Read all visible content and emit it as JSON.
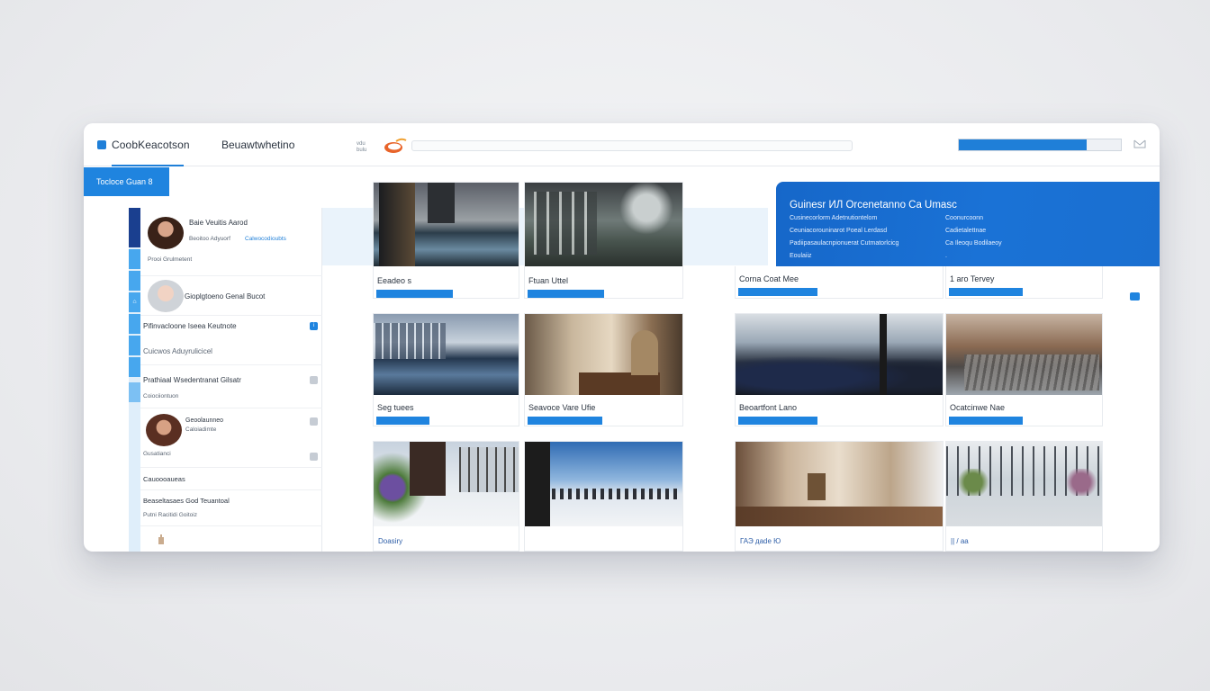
{
  "header": {
    "app_title": "CoobKeacotson",
    "nav_item": "Beuawtwhetino",
    "mini_logo_text": "vdu\nbulu",
    "progress_fraction": 0.79,
    "accent": "#1f7fd8",
    "active_tab": "Tocloce Guan 8"
  },
  "sidebar": {
    "rail_icons": [
      "-",
      "-",
      "⌂",
      "-",
      "-",
      "-",
      "-",
      "-"
    ],
    "items": [
      {
        "title": "Baie Veuitis Aarod",
        "sub": "Beoitoo Adyuorf",
        "link": "Calwocodioubts",
        "meta": "Prooi Grulmetent",
        "avatar": "person-dark-hair"
      },
      {
        "title": "Gioplgtoeno Genal Bucot",
        "avatar": "person-grey-hair"
      },
      {
        "title": "Pifinvacloone Iseea Keutnote",
        "badge": "i"
      },
      {
        "title": "Cuicwos Aduyrulicicel"
      },
      {
        "title": "Prathiaal Wsedentranat Gilsatr",
        "sub": "Coiociiontuon"
      },
      {
        "title": "Geoolaunneo",
        "sub": "Caloiadimte",
        "meta": "Gusatianci",
        "avatar": "person-curly-hair"
      },
      {
        "title": "Cauoooaueas"
      },
      {
        "title": "Beaseltasaes God Teuantoal",
        "sub": "Putni Racitidi Goitoiz"
      }
    ]
  },
  "gallery": {
    "cards": [
      {
        "title": "Eeadeo s",
        "progress": 0.52
      },
      {
        "title": "Ftuan Uttel",
        "progress": 0.48
      },
      {
        "title": "Corna Coat Mee",
        "progress": 0.38
      },
      {
        "title": "1 aro Tervey",
        "progress": 0.47
      },
      {
        "title": "Seg tuees",
        "progress": 0.36
      },
      {
        "title": "Seavoce Vare Ufie",
        "progress": 0.47
      },
      {
        "title": "Beoartfont Lano",
        "progress": 0.38
      },
      {
        "title": "Ocatcinwe Nae",
        "progress": 0.47
      }
    ],
    "footer_left": "Doasiry",
    "footer_mid": "ГАЭ даdе Ю",
    "footer_right": "|| / aa"
  },
  "promo": {
    "title": "Guinesr   ИЛ   Orcenetanno   Ca  Umasc",
    "lines_left": [
      "Cusinecorlorm Adetnutiontelom",
      "Ceuniacorouninarot Poeal Lerdasd",
      "Padiipasaulacnpionuerat Cutmatorlcicg",
      "Eoulaiiz"
    ],
    "lines_right": [
      "Coonurcoonn",
      "Cadietalettnae",
      "Ca Ileoqu Bodilaeoy",
      "."
    ]
  }
}
